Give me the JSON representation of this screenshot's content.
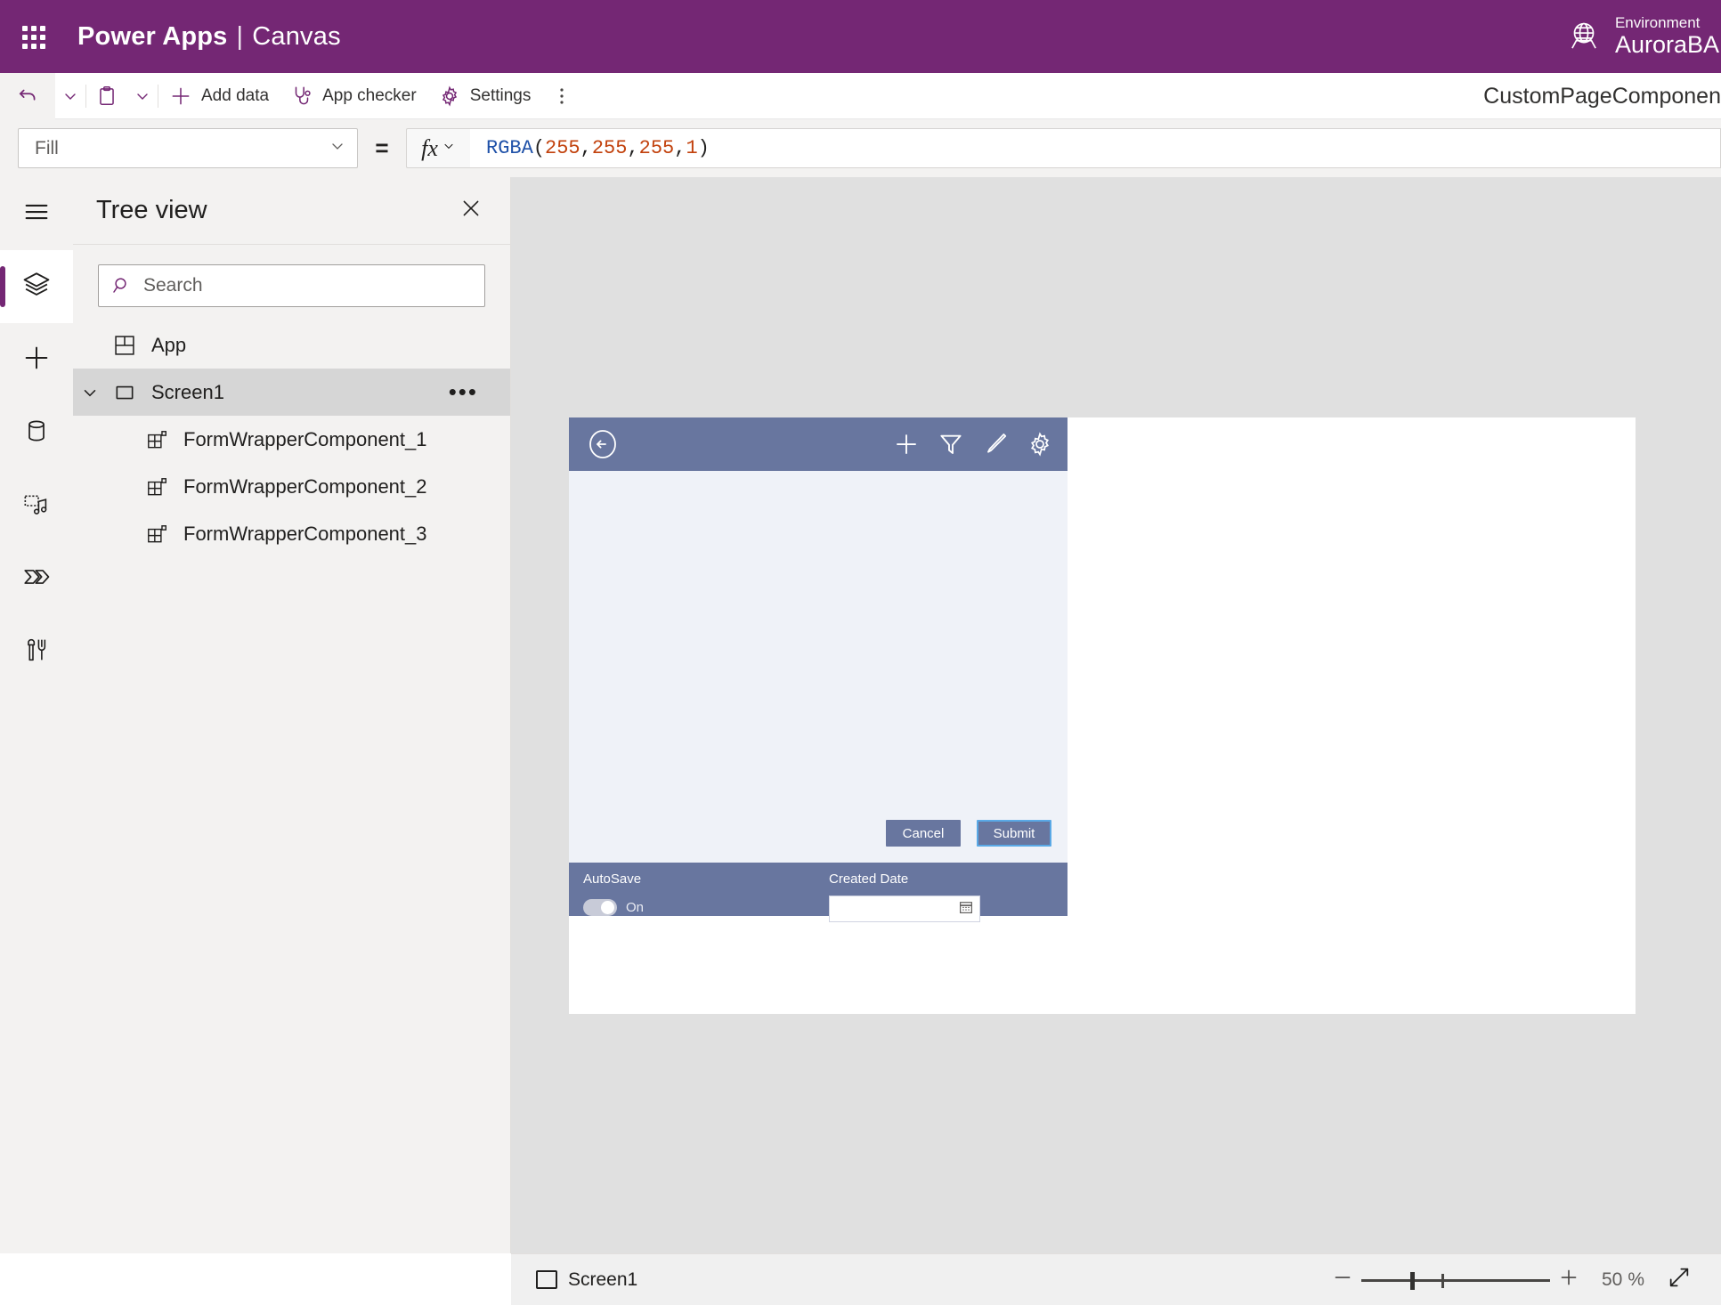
{
  "topbar": {
    "waffle_icon": "app-launcher-icon",
    "brand": "Power Apps",
    "separator": "|",
    "brand_sub": "Canvas",
    "globe_icon": "globe-icon",
    "environment_label": "Environment",
    "environment_name": "AuroraBA"
  },
  "toolbar": {
    "undo_icon": "undo-icon",
    "undo_caret_icon": "chevron-down-icon",
    "paste_icon": "clipboard-paste-icon",
    "paste_caret_icon": "chevron-down-icon",
    "add_data_icon": "plus-icon",
    "add_data_label": "Add data",
    "app_checker_icon": "stethoscope-icon",
    "app_checker_label": "App checker",
    "settings_icon": "gear-icon",
    "settings_label": "Settings",
    "more_icon": "more-vertical-icon",
    "page_name": "CustomPageComponen"
  },
  "formula_bar": {
    "property": "Fill",
    "property_caret_icon": "chevron-down-icon",
    "equals": "=",
    "fx_label": "fx",
    "fx_caret_icon": "chevron-down-icon",
    "formula_tokens": [
      {
        "text": "RGBA",
        "type": "fn"
      },
      {
        "text": "(",
        "type": "punc"
      },
      {
        "text": "255",
        "type": "num"
      },
      {
        "text": ", ",
        "type": "punc"
      },
      {
        "text": "255",
        "type": "num"
      },
      {
        "text": ", ",
        "type": "punc"
      },
      {
        "text": "255",
        "type": "num"
      },
      {
        "text": ", ",
        "type": "punc"
      },
      {
        "text": "1",
        "type": "num"
      },
      {
        "text": ")",
        "type": "punc"
      }
    ],
    "formula_text": "RGBA(255, 255, 255, 1)"
  },
  "rail": {
    "items": [
      {
        "name": "menu-hamburger",
        "icon": "hamburger-icon",
        "active": false
      },
      {
        "name": "tree-view",
        "icon": "layers-icon",
        "active": true
      },
      {
        "name": "insert",
        "icon": "plus-icon",
        "active": false
      },
      {
        "name": "data",
        "icon": "database-icon",
        "active": false
      },
      {
        "name": "media",
        "icon": "media-icon",
        "active": false
      },
      {
        "name": "power-automate",
        "icon": "power-automate-icon",
        "active": false
      },
      {
        "name": "tools",
        "icon": "tools-icon",
        "active": false
      }
    ]
  },
  "tree_view": {
    "title": "Tree view",
    "close_icon": "close-icon",
    "search_icon": "search-icon",
    "search_placeholder": "Search",
    "search_value": "",
    "items": [
      {
        "label": "App",
        "icon": "app-icon",
        "level": 0,
        "selected": false,
        "expandable": false,
        "has_menu": false
      },
      {
        "label": "Screen1",
        "icon": "screen-icon",
        "level": 0,
        "selected": true,
        "expandable": true,
        "expanded": true,
        "chevron_icon": "chevron-down-icon",
        "has_menu": true,
        "menu_icon": "more-horizontal-icon"
      },
      {
        "label": "FormWrapperComponent_1",
        "icon": "component-icon",
        "level": 1,
        "selected": false,
        "expandable": false,
        "has_menu": false
      },
      {
        "label": "FormWrapperComponent_2",
        "icon": "component-icon",
        "level": 1,
        "selected": false,
        "expandable": false,
        "has_menu": false
      },
      {
        "label": "FormWrapperComponent_3",
        "icon": "component-icon",
        "level": 1,
        "selected": false,
        "expandable": false,
        "has_menu": false
      }
    ]
  },
  "canvas": {
    "app_header": {
      "back_icon": "back-arrow-circle-icon",
      "icons": [
        {
          "name": "add-icon",
          "glyph": "plus"
        },
        {
          "name": "filter-icon",
          "glyph": "funnel"
        },
        {
          "name": "edit-icon",
          "glyph": "pencil"
        },
        {
          "name": "settings-icon",
          "glyph": "gear"
        }
      ]
    },
    "buttons": {
      "cancel_label": "Cancel",
      "submit_label": "Submit"
    },
    "footer": {
      "autosave_label": "AutoSave",
      "autosave_state": "On",
      "created_date_label": "Created Date",
      "created_date_value": "",
      "calendar_icon": "calendar-icon"
    }
  },
  "status_bar": {
    "screen_icon": "screen-icon",
    "screen_name": "Screen1",
    "zoom_out_icon": "minus-icon",
    "zoom_in_icon": "plus-icon",
    "zoom_value": "50",
    "zoom_unit": "%",
    "fit_screen_icon": "expand-diagonal-icon"
  },
  "colors": {
    "brand_purple": "#742774",
    "app_blue": "#68769f",
    "app_body": "#eff2f8",
    "selection_blue": "#5aa9e6",
    "workspace_gray": "#e0e0e0"
  }
}
